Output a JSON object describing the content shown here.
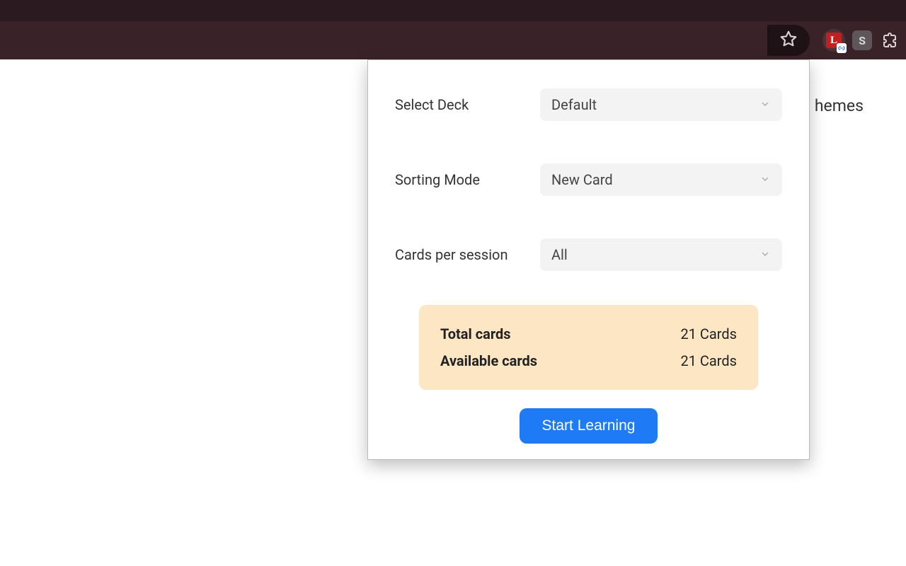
{
  "page": {
    "nav_fragment": "hemes"
  },
  "popup": {
    "deck": {
      "label": "Select Deck",
      "value": "Default"
    },
    "sorting": {
      "label": "Sorting Mode",
      "value": "New Card"
    },
    "per_session": {
      "label": "Cards per session",
      "value": "All"
    },
    "summary": {
      "total_label": "Total cards",
      "total_value": "21 Cards",
      "available_label": "Available cards",
      "available_value": "21 Cards"
    },
    "start_button": "Start Learning"
  },
  "extensions": {
    "badge_l": "L",
    "badge_s": "S"
  }
}
